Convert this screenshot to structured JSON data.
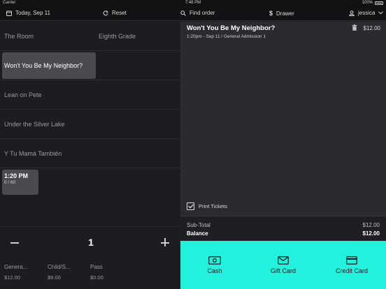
{
  "status_bar": {
    "carrier": "Carrier",
    "time": "7:48 PM",
    "battery": "100%"
  },
  "nav": {
    "date": "Today, Sep 11",
    "reset": "Reset",
    "find_order": "Find order",
    "drawer": "Drawer",
    "user": "jessica"
  },
  "films": {
    "row1_left": "The Room",
    "row1_right": "Eighth Grade",
    "row2_left": "Won't You Be My Neighbor?",
    "row3_left": "Lean on Pete",
    "row4_left": "Under the Silver Lake",
    "row5_left": "Y Tu Mamá También"
  },
  "showtime": {
    "time": "1:20 PM",
    "capacity": "0 / 60"
  },
  "quantity": {
    "value": "1"
  },
  "ticket_types": [
    {
      "name": "Genera...",
      "price": "$12.00"
    },
    {
      "name": "Child/S...",
      "price": "$9.00"
    },
    {
      "name": "Pass",
      "price": "$0.00"
    }
  ],
  "order": {
    "title": "Won't You Be My Neighbor?",
    "subtitle": "1:20pm - Sep 11 / General Admission 1",
    "price": "$12.00"
  },
  "print_tickets_label": "Print Tickets",
  "totals": {
    "subtotal_label": "Sub-Total",
    "subtotal_value": "$12.00",
    "balance_label": "Balance",
    "balance_value": "$12.00"
  },
  "payments": {
    "cash": "Cash",
    "gift_card": "Gift Card",
    "credit_card": "Credit Card"
  },
  "colors": {
    "accent": "#21f1dd",
    "selected": "#4a4b4f",
    "background": "#1c1d20"
  }
}
